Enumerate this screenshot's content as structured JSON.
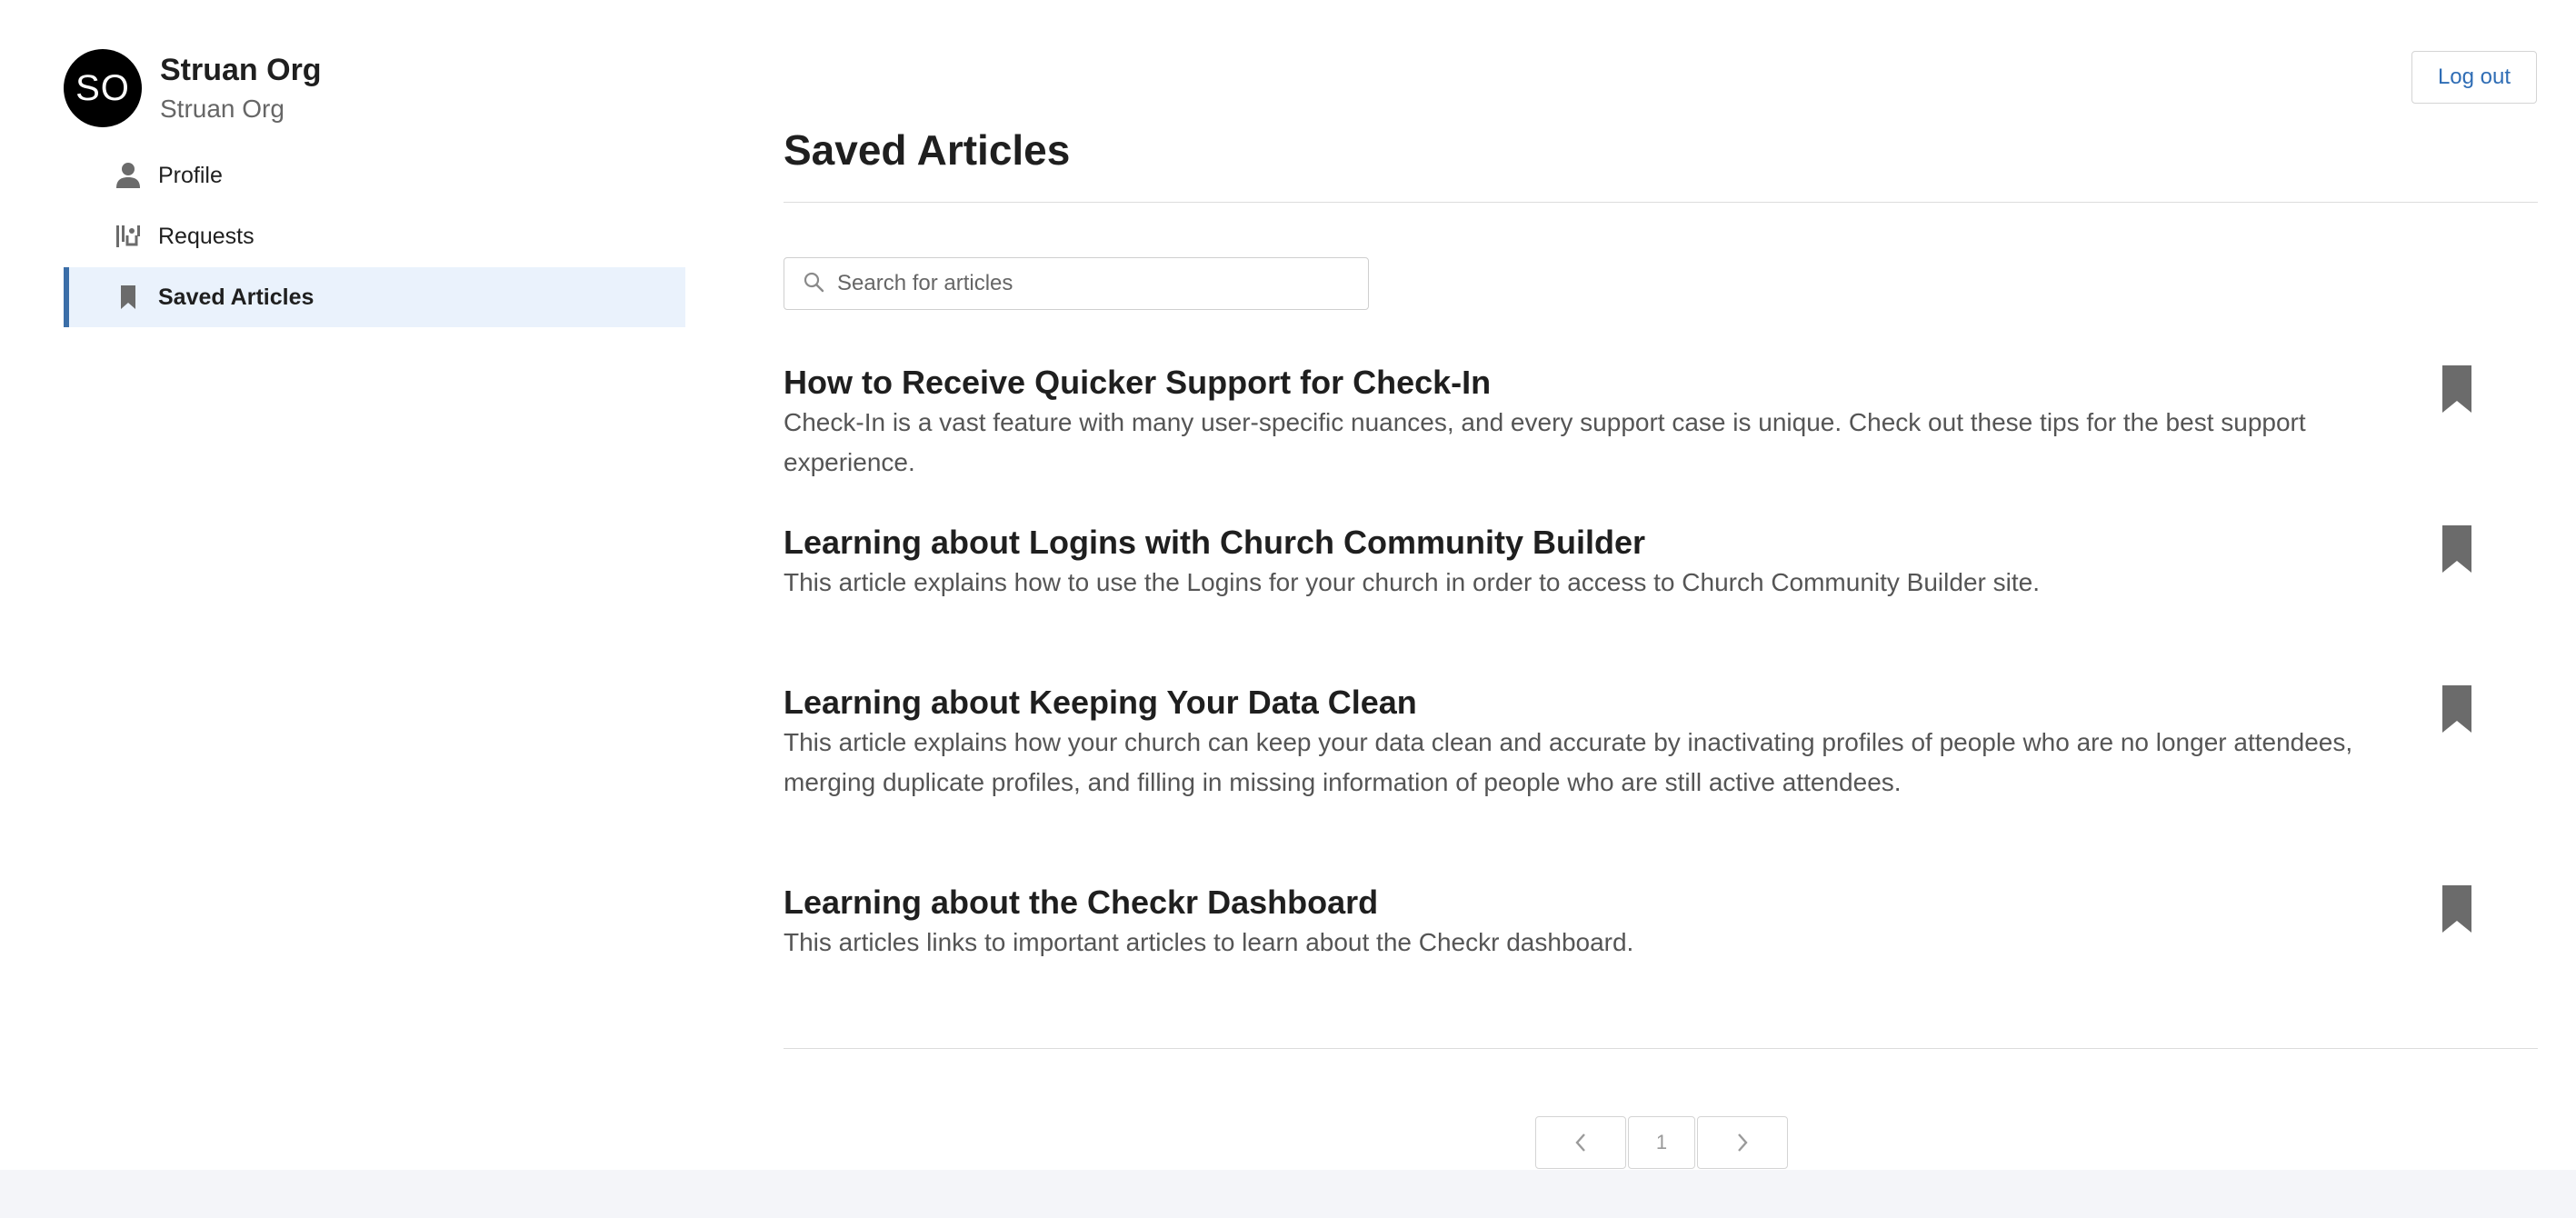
{
  "user": {
    "avatar_initials": "SO",
    "name": "Struan Org",
    "org": "Struan Org"
  },
  "sidebar": {
    "items": [
      {
        "label": "Profile",
        "icon": "person-icon",
        "active": false
      },
      {
        "label": "Requests",
        "icon": "requests-icon",
        "active": false
      },
      {
        "label": "Saved Articles",
        "icon": "bookmark-icon",
        "active": true
      }
    ]
  },
  "header": {
    "logout_label": "Log out"
  },
  "main": {
    "title": "Saved Articles",
    "search": {
      "placeholder": "Search for articles",
      "value": ""
    },
    "articles": [
      {
        "title": "How to Receive Quicker Support for Check-In",
        "description": "Check-In is a vast feature with many user-specific nuances, and every support case is unique. Check out these tips for the best support experience."
      },
      {
        "title": "Learning about Logins with Church Community Builder",
        "description": "This article explains how to use the Logins for your church in order to access to Church Community Builder site."
      },
      {
        "title": "Learning about Keeping Your Data Clean",
        "description": "This article explains how your church can keep your data clean and accurate by inactivating profiles of people who are no longer attendees, merging duplicate profiles, and filling in missing information of people who are still active attendees."
      },
      {
        "title": "Learning about the Checkr Dashboard",
        "description": "This articles links to important articles to learn about the Checkr dashboard."
      }
    ],
    "pagination": {
      "current_page": "1"
    }
  },
  "colors": {
    "accent": "#3b6ea8",
    "active_nav_bg": "#eaf2fc",
    "link": "#2f6db5",
    "icon_gray": "#6b6b6b",
    "footer_bg": "#f4f5f9"
  }
}
